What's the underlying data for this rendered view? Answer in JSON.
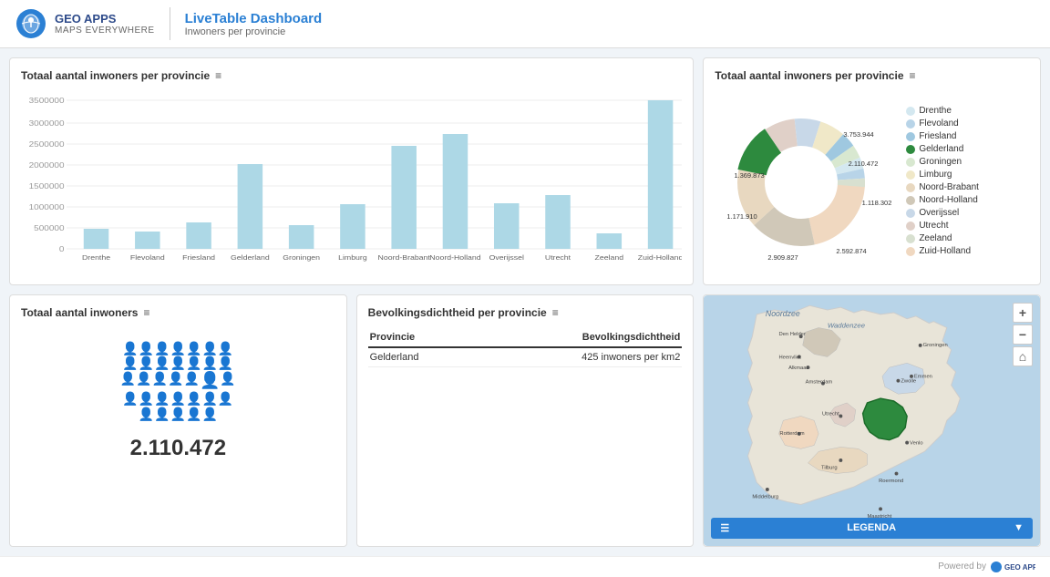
{
  "header": {
    "logo_brand": "GEO APPS",
    "logo_tagline": "MAPS EVERYWHERE",
    "title": "LiveTable Dashboard",
    "subtitle": "Inwoners per provincie"
  },
  "bar_chart": {
    "title": "Totaal aantal inwoners per provincie",
    "y_axis": [
      "3500000",
      "3000000",
      "2500000",
      "2000000",
      "1500000",
      "1000000",
      "500000",
      "0"
    ],
    "provinces": [
      "Drenthe",
      "Flevoland",
      "Friesland",
      "Gelderland",
      "Groningen",
      "Limburg",
      "Noord-Brabant",
      "Noord-Holland",
      "Overijssel",
      "Utrecht",
      "Zeeland",
      "Zuid-Holland"
    ],
    "values": [
      490000,
      420000,
      650000,
      2110472,
      585000,
      1115000,
      2560000,
      2850000,
      1140000,
      1340000,
      385000,
      3700000
    ],
    "highlighted": "Gelderland"
  },
  "donut_chart": {
    "title": "Totaal aantal inwoners per provincie",
    "segments": [
      {
        "name": "Drenthe",
        "value": 490000,
        "color": "#d4e8f0",
        "label": ""
      },
      {
        "name": "Flevoland",
        "value": 420000,
        "color": "#b8d4e8",
        "label": ""
      },
      {
        "name": "Friesland",
        "value": 650000,
        "color": "#9fc8e0",
        "label": ""
      },
      {
        "name": "Gelderland",
        "value": 2110472,
        "color": "#2d8a3e",
        "label": "2.110.472"
      },
      {
        "name": "Groningen",
        "value": 585000,
        "color": "#d8e8d0",
        "label": ""
      },
      {
        "name": "Limburg",
        "value": 1115000,
        "color": "#f0e8c8",
        "label": ""
      },
      {
        "name": "Noord-Brabant",
        "value": 2560000,
        "color": "#e8d8c0",
        "label": "2.592.874"
      },
      {
        "name": "Noord-Holland",
        "value": 2850000,
        "color": "#d0c8b8",
        "label": "3.753.944"
      },
      {
        "name": "Overijssel",
        "value": 1140000,
        "color": "#c8d8e8",
        "label": ""
      },
      {
        "name": "Utrecht",
        "value": 1340000,
        "color": "#e0d0c8",
        "label": "1.369.873"
      },
      {
        "name": "Zeeland",
        "value": 385000,
        "color": "#d8e0d0",
        "label": ""
      },
      {
        "name": "Zuid-Holland",
        "value": 3700000,
        "color": "#f0d8c0",
        "label": ""
      }
    ],
    "labels_on_chart": [
      "3.753.944",
      "1.369.873",
      "1.171.910",
      "2.909.827",
      "2.592.874",
      "1.118.302",
      "2.110.472"
    ]
  },
  "total_inhabitants": {
    "title": "Totaal aantal inwoners",
    "value": "2.110.472"
  },
  "density_table": {
    "title": "Bevolkingsdichtheid per provincie",
    "col_province": "Provincie",
    "col_density": "Bevolkingsdichtheid",
    "rows": [
      {
        "province": "Gelderland",
        "density": "425 inwoners per km2"
      }
    ]
  },
  "map": {
    "label_noord": "Noordzee",
    "label_wad": "Waddenzee",
    "btn_plus": "+",
    "btn_minus": "−",
    "btn_home": "⌂",
    "legend_label": "LEGENDA",
    "cities": [
      "Groningen",
      "Heenvliet",
      "Emmen",
      "Den Helder",
      "Alkmaar",
      "Amsterdam",
      "Zwolle",
      "Utrecht",
      "Rotterdam",
      "Tilburg",
      "Middelburg",
      "Venlo",
      "Roermond",
      "Maastricht"
    ]
  },
  "footer": {
    "powered_by": "Powered by"
  }
}
